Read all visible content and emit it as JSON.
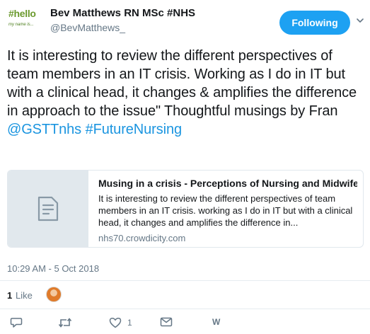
{
  "author": {
    "avatar_text_main": "#hello",
    "avatar_text_sub": "my name is...",
    "display_name": "Bev Matthews RN MSc #NHS",
    "handle": "@BevMatthews_"
  },
  "follow_button": {
    "label": "Following"
  },
  "tweet": {
    "text_main": "It is interesting to review the different perspectives of team members in an IT crisis. Working as I do in IT but with a clinical head, it changes & amplifies the difference in approach to the issue\" Thoughtful musings by Fran ",
    "mention": "@GSTTnhs",
    "hashtag": "#FutureNursing"
  },
  "card": {
    "title": "Musing in a crisis - Perceptions of Nursing and Midwifery",
    "description": "It is interesting to review the different perspectives of team members in an IT crisis.  working as I do in IT but with a clinical head, it changes and amplifies the difference in...",
    "domain": "nhs70.crowdicity.com",
    "thumb_icon": "document-icon"
  },
  "timestamp": "10:29 AM - 5 Oct 2018",
  "likes": {
    "count": "1",
    "label": "Like"
  },
  "actions": {
    "reply_icon": "reply-icon",
    "retweet_icon": "retweet-icon",
    "like_icon": "heart-icon",
    "like_count": "1",
    "extra_glyph": "W"
  },
  "colors": {
    "accent": "#1da1f2",
    "link": "#1b95e0",
    "muted": "#657786",
    "border": "#e1e8ed"
  }
}
